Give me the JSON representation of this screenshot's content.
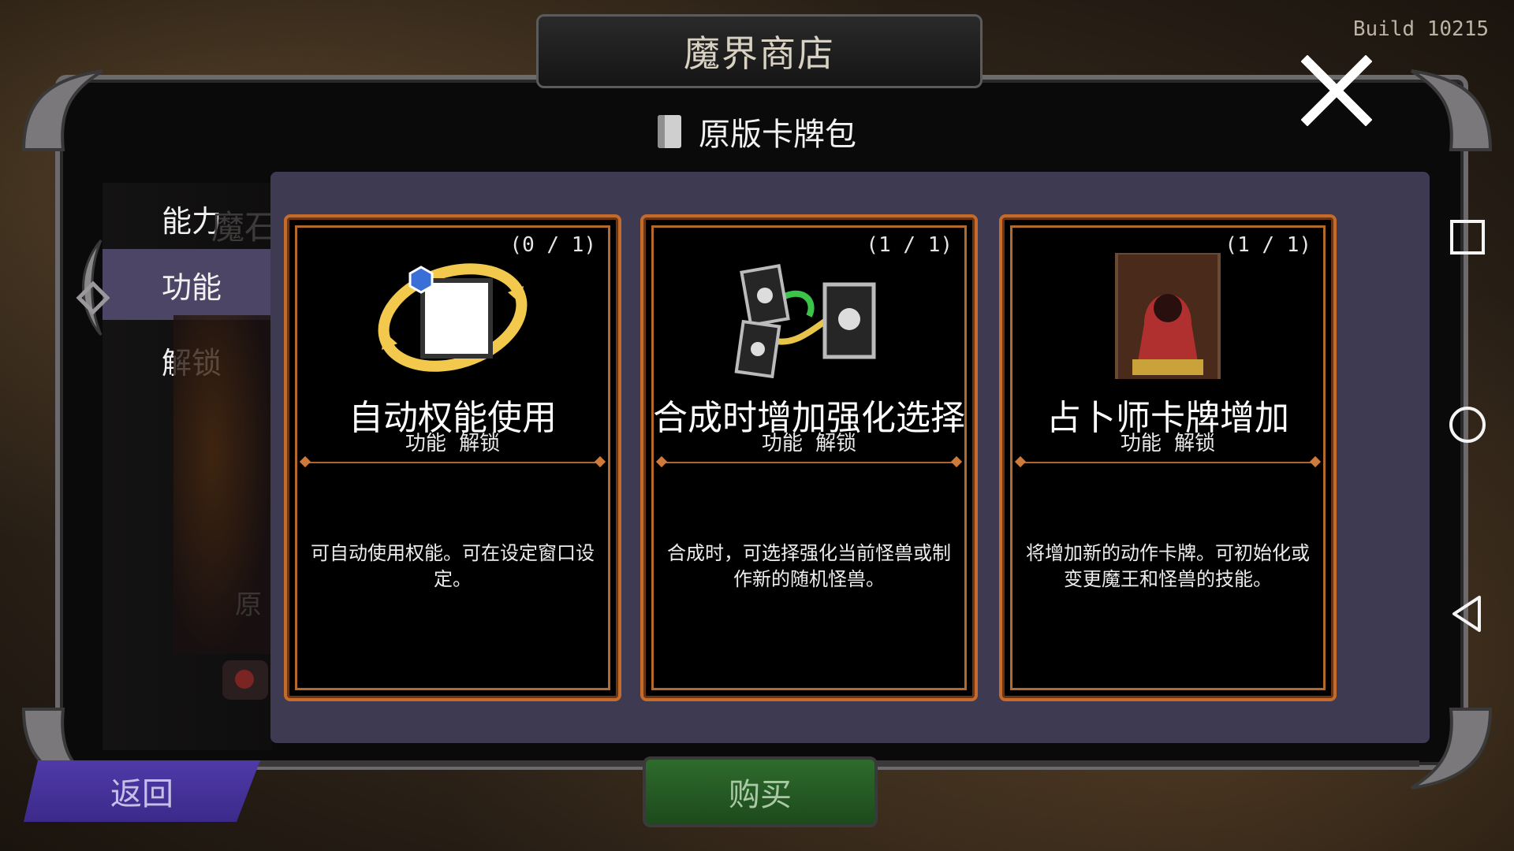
{
  "build": "Build 10215",
  "title": "魔界商店",
  "header": {
    "label": "原版卡牌包"
  },
  "sidebar": {
    "items": [
      {
        "label": "能力"
      },
      {
        "label": "功能"
      },
      {
        "label": "解锁"
      }
    ],
    "active_index": 1,
    "ghost_top": "魔石",
    "ghost_bottom": "原"
  },
  "cards": [
    {
      "count": "(0 / 1)",
      "name": "自动权能使用",
      "sub": "功能 解锁",
      "desc": "可自动使用权能。可在设定窗口设定。",
      "icon": "auto-cycle-icon"
    },
    {
      "count": "(1 / 1)",
      "name": "合成时增加强化选择",
      "sub": "功能 解锁",
      "desc": "合成时，可选择强化当前怪兽或制作新的随机怪兽。",
      "icon": "monster-cards-icon"
    },
    {
      "count": "(1 / 1)",
      "name": "占卜师卡牌增加",
      "sub": "功能 解锁",
      "desc": "将增加新的动作卡牌。可初始化或变更魔王和怪兽的技能。",
      "icon": "fortune-teller-icon"
    }
  ],
  "buttons": {
    "back": "返回",
    "buy": "购买"
  },
  "colors": {
    "panel": "#3d3a52",
    "card_border": "#c46a2a",
    "active_tab": "#4d4566",
    "back_button": "#4f3aa8",
    "buy_button": "#2e6b2c"
  }
}
